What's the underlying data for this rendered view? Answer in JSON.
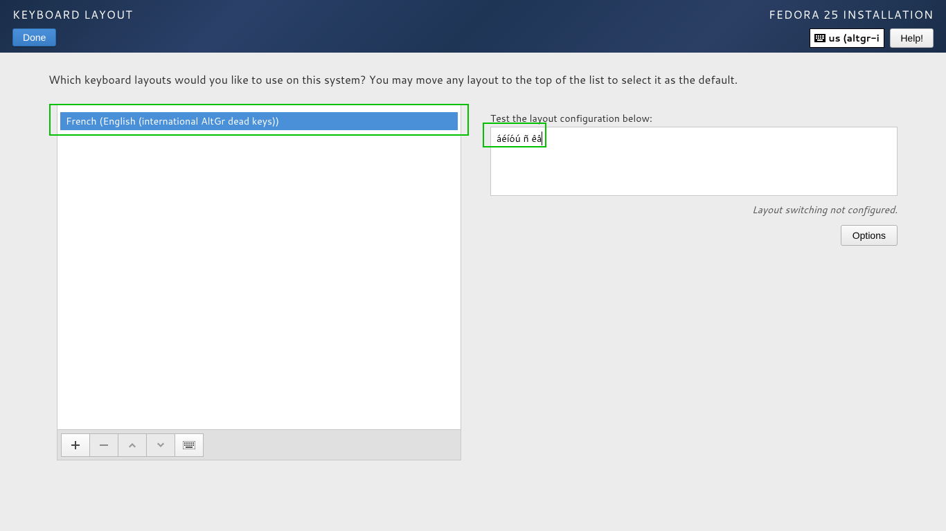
{
  "header": {
    "page_title": "KEYBOARD LAYOUT",
    "install_title": "FEDORA 25 INSTALLATION",
    "done_label": "Done",
    "help_label": "Help!",
    "layout_indicator": "us (altgr-in..."
  },
  "instruction": "Which keyboard layouts would you like to use on this system?  You may move any layout to the top of the list to select it as the default.",
  "layout_list": {
    "items": [
      "French (English (international AltGr dead keys))"
    ]
  },
  "toolbar": {
    "add_icon": "plus-icon",
    "remove_icon": "minus-icon",
    "up_icon": "chevron-up-icon",
    "down_icon": "chevron-down-icon",
    "keyboard_icon": "keyboard-icon"
  },
  "test": {
    "label": "Test the layout configuration below:",
    "value": "áéíóú ñ êâ"
  },
  "status_text": "Layout switching not configured.",
  "options_label": "Options"
}
